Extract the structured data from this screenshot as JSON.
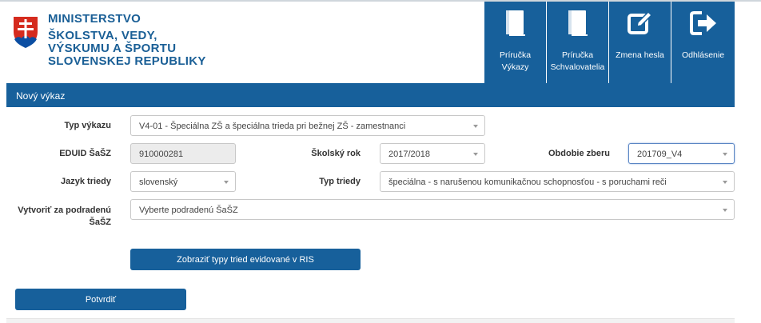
{
  "logo": {
    "line1": "MINISTERSTVO",
    "line2": "ŠKOLSTVA, VEDY, VÝSKUMU A ŠPORTU SLOVENSKEJ REPUBLIKY",
    "colors": {
      "brand": "#1a5f96",
      "crest_red": "#d52b1e",
      "crest_blue": "#0b4ea2"
    }
  },
  "nav": {
    "items": [
      {
        "label": "Príručka Výkazy",
        "icon": "book-icon"
      },
      {
        "label": "Príručka Schvalovatelia",
        "icon": "book-icon"
      },
      {
        "label": "Zmena hesla",
        "icon": "edit-icon"
      },
      {
        "label": "Odhlásenie",
        "icon": "logout-icon"
      }
    ]
  },
  "panel": {
    "title": "Nový výkaz"
  },
  "form": {
    "typ_vykazu": {
      "label": "Typ výkazu",
      "value": "V4-01 - Špeciálna ZŠ a špeciálna trieda pri bežnej ZŠ - zamestnanci"
    },
    "eduid": {
      "label": "EDUID ŠaŠZ",
      "value": "910000281"
    },
    "skolsky_rok": {
      "label": "Školský rok",
      "value": "2017/2018"
    },
    "obdobie_zberu": {
      "label": "Obdobie zberu",
      "value": "201709_V4"
    },
    "jazyk_triedy": {
      "label": "Jazyk triedy",
      "value": "slovenský"
    },
    "typ_triedy": {
      "label": "Typ triedy",
      "value": "špeciálna - s narušenou komunikačnou schopnosťou - s poruchami reči"
    },
    "podradenu": {
      "label": "Vytvoriť za podradenú ŠaŠZ",
      "placeholder": "Vyberte podradenú ŠaŠZ"
    }
  },
  "buttons": {
    "zobrazit": "Zobraziť typy tried evidované v RIS",
    "potvrdit": "Potvrdiť"
  },
  "colors": {
    "primary": "#17609b"
  }
}
